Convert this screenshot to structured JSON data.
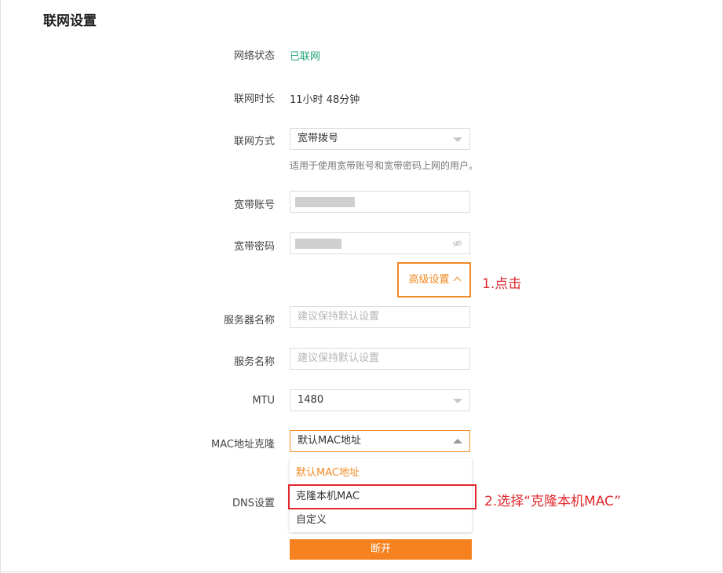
{
  "page": {
    "title": "联网设置"
  },
  "network_status": {
    "label": "网络状态",
    "value": "已联网",
    "color": "#1fa27a"
  },
  "online_duration": {
    "label": "联网时长",
    "value": "11小时 48分钟"
  },
  "connection_type": {
    "label": "联网方式",
    "value": "宽带拨号",
    "hint": "适用于使用宽带账号和宽带密码上网的用户。"
  },
  "broadband_account": {
    "label": "宽带账号"
  },
  "broadband_password": {
    "label": "宽带密码"
  },
  "advanced": {
    "label": "高级设置"
  },
  "server_name": {
    "label": "服务器名称",
    "placeholder": "建议保持默认设置"
  },
  "service_name": {
    "label": "服务名称",
    "placeholder": "建议保持默认设置"
  },
  "mtu": {
    "label": "MTU",
    "value": "1480"
  },
  "mac_clone": {
    "label": "MAC地址克隆",
    "value": "默认MAC地址",
    "options": [
      "默认MAC地址",
      "克隆本机MAC",
      "自定义"
    ]
  },
  "dns": {
    "label": "DNS设置"
  },
  "disconnect": {
    "label": "断开"
  },
  "annotations": {
    "step1": "1.点击",
    "step2": "2.选择“克隆本机MAC”"
  },
  "colors": {
    "accent": "#f08a24",
    "annotation_red": "#e1282d",
    "button_orange": "#f5821f"
  }
}
